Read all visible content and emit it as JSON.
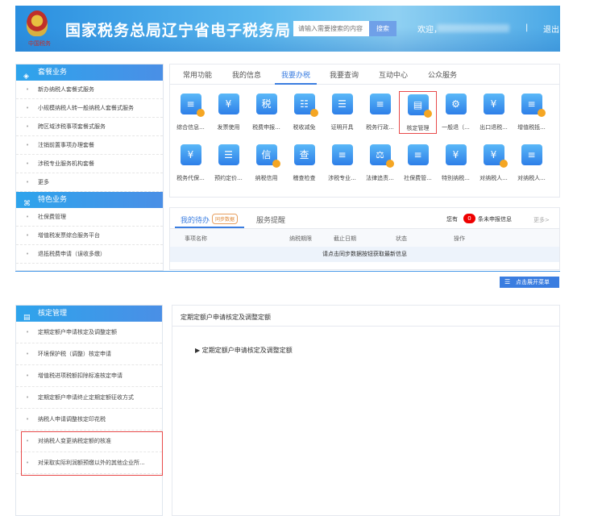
{
  "header": {
    "emblem_text": "中国税务",
    "title": "国家税务总局辽宁省电子税务局",
    "search_placeholder": "请输入需要搜索的内容",
    "search_button": "搜索",
    "welcome": "欢迎，",
    "separator": "|",
    "logout": "退出"
  },
  "sidebar_top": {
    "package": {
      "title": "套餐业务",
      "items": [
        "新办纳税人套餐式服务",
        "小规模纳税人转一般纳税人套餐式服务",
        "跨区域涉税事项套餐式服务",
        "注销前置事项办理套餐",
        "涉税专业服务机构套餐",
        "更多"
      ]
    },
    "featured": {
      "title": "特色业务",
      "items": [
        "社保费管理",
        "增值税发票综合服务平台",
        "退抵税费申请（误收多缴）"
      ]
    }
  },
  "tabs": [
    "常用功能",
    "我的信息",
    "我要办税",
    "我要查询",
    "互动中心",
    "公众服务"
  ],
  "active_tab": "我要办税",
  "functions": [
    {
      "label": "综合信息...",
      "glyph": "≡"
    },
    {
      "label": "发票使用",
      "glyph": "¥"
    },
    {
      "label": "税费申报...",
      "glyph": "税"
    },
    {
      "label": "税收减免",
      "glyph": "☷"
    },
    {
      "label": "证明开具",
      "glyph": "☰"
    },
    {
      "label": "税务行政...",
      "glyph": "≡"
    },
    {
      "label": "核定管理",
      "glyph": "▤",
      "highlighted": true
    },
    {
      "label": "一般退（...",
      "glyph": "⚙"
    },
    {
      "label": "出口退税...",
      "glyph": "¥"
    },
    {
      "label": "增值税抵...",
      "glyph": "≡"
    },
    {
      "label": "税务代保...",
      "glyph": "¥"
    },
    {
      "label": "预约定价...",
      "glyph": "☰"
    },
    {
      "label": "纳税信用",
      "glyph": "信"
    },
    {
      "label": "稽查检查",
      "glyph": "查"
    },
    {
      "label": "涉税专业...",
      "glyph": "≡"
    },
    {
      "label": "法律追责...",
      "glyph": "⚖"
    },
    {
      "label": "社保费管...",
      "glyph": "≡"
    },
    {
      "label": "特别纳税...",
      "glyph": "¥"
    },
    {
      "label": "对纳税人...",
      "glyph": "¥"
    },
    {
      "label": "对纳税人...",
      "glyph": "≡"
    }
  ],
  "todo": {
    "tab1": "我的待办",
    "sync_badge": "同步数据",
    "tab2": "服务提醒",
    "you_have": "您有",
    "count": "0",
    "unreported": "条未申报信息",
    "more": "更多>",
    "columns": [
      "事项名称",
      "纳税期限",
      "截止日期",
      "状态",
      "操作"
    ],
    "empty": "请点击同步数据按钮获取最新信息"
  },
  "expand_menu": "点击展开菜单",
  "sidebar_bottom": {
    "title": "核定管理",
    "items": [
      "定期定额户申请核定及调整定额",
      "环境保护税（调整）核定申请",
      "增值税进项税额扣除标准核定申请",
      "定期定额户申请终止定期定额征收方式",
      "纳税人申请调整核定印花税",
      "对纳税人变更纳税定额的核准",
      "对采取实际利润额预缴以外的其他企业所..."
    ]
  },
  "content": {
    "title": "定期定额户申请核定及调整定额",
    "tree_node": "定期定额户申请核定及调整定额"
  }
}
